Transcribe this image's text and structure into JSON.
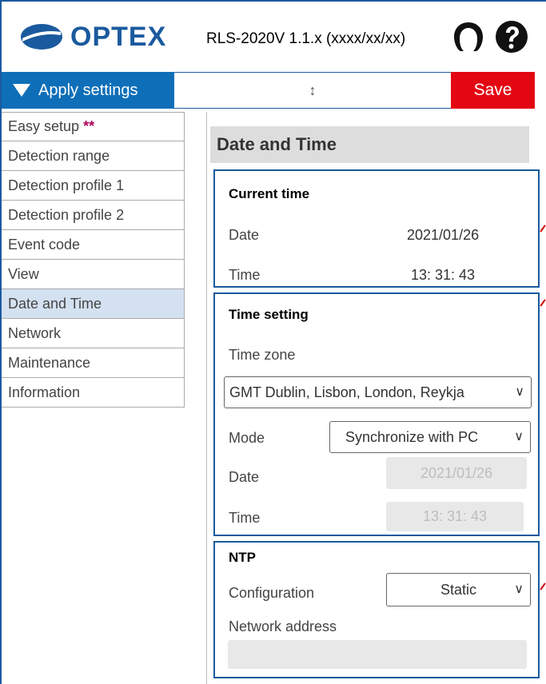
{
  "header": {
    "brand": "OPTEX",
    "model": "RLS-2020V 1.1.x (xxxx/xx/xx)",
    "icons": [
      "user-icon",
      "help-icon"
    ]
  },
  "toolbar": {
    "apply_label": "Apply settings",
    "resize_glyph": "↕",
    "save_label": "Save"
  },
  "sidebar": {
    "items": [
      {
        "label": "Easy setup",
        "badge": "**"
      },
      {
        "label": "Detection range"
      },
      {
        "label": "Detection profile 1"
      },
      {
        "label": "Detection profile 2"
      },
      {
        "label": "Event code"
      },
      {
        "label": "View"
      },
      {
        "label": "Date and Time",
        "active": true
      },
      {
        "label": "Network"
      },
      {
        "label": "Maintenance"
      },
      {
        "label": "Information"
      }
    ]
  },
  "main": {
    "title": "Date and Time",
    "current_time": {
      "heading": "Current time",
      "date_label": "Date",
      "date_value": "2021/01/26",
      "time_label": "Time",
      "time_value": "13: 31: 43"
    },
    "time_setting": {
      "heading": "Time setting",
      "timezone_label": "Time zone",
      "timezone_value": "GMT Dublin, Lisbon, London, Reykja",
      "mode_label": "Mode",
      "mode_value": "Synchronize with PC",
      "date_label": "Date",
      "date_value": "2021/01/26",
      "time_label": "Time",
      "time_value": "13: 31: 43"
    },
    "ntp": {
      "heading": "NTP",
      "configuration_label": "Configuration",
      "configuration_value": "Static",
      "network_address_label": "Network address",
      "network_address_value": ""
    }
  },
  "colors": {
    "brand_blue": "#1a5a9e",
    "apply_blue": "#0e6fb8",
    "save_red": "#e30613",
    "active_nav": "#d3e1f1"
  }
}
